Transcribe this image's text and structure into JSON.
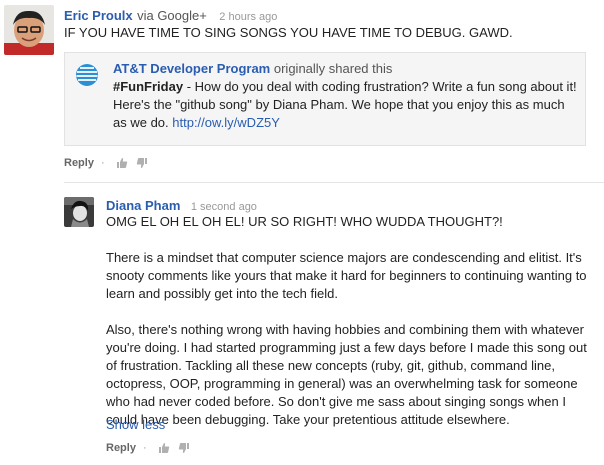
{
  "post": {
    "author": "Eric Proulx",
    "via": "via Google+",
    "time": "2 hours ago",
    "text": "IF YOU HAVE TIME TO SING SONGS YOU HAVE TIME TO DEBUG. GAWD.",
    "shared": {
      "author": "AT&T Developer Program",
      "action": "originally shared this",
      "hashtag": "#FunFriday",
      "text": " - How do you deal with coding frustration? Write a fun song about it! Here's the \"github song\" by Diana Pham. We hope that you enjoy this as much as we do. ",
      "link": "http://ow.ly/wDZ5Y"
    },
    "actions": {
      "reply": "Reply",
      "separator": "·"
    }
  },
  "comment": {
    "author": "Diana Pham",
    "time": "1 second ago",
    "line1": "OMG EL OH EL OH EL! UR SO RIGHT! WHO WUDDA THOUGHT?!",
    "para1": "There is a mindset that computer science majors are condescending and elitist. It's snooty comments like yours that make it hard for beginners to continuing wanting to learn and possibly get into the tech field.",
    "para2": "Also, there's nothing wrong with having hobbies and combining them with whatever you're doing. I had started programming just a few days before I made this song out of frustration. Tackling all these new concepts (ruby, git, github, command line, octopress, OOP, programming in general) was an overwhelming task for someone who had never coded before. So don't give me sass about singing songs when I could have been debugging. Take your pretentious attitude elsewhere.",
    "show_less": "Show less",
    "actions": {
      "reply": "Reply",
      "separator": "·"
    }
  },
  "colors": {
    "link": "#2a5db0",
    "share_bg": "#f5f5f5"
  },
  "icons": [
    "thumbs-up-icon",
    "thumbs-down-icon",
    "att-logo-icon"
  ]
}
